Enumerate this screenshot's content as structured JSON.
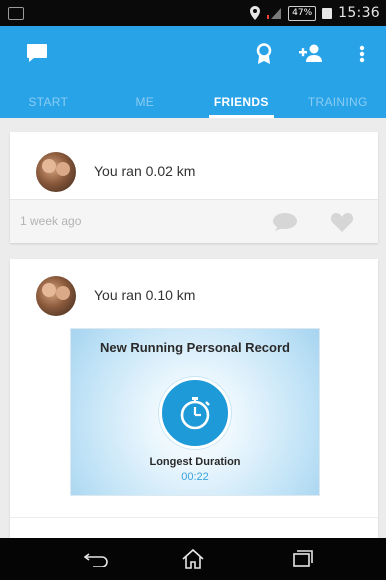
{
  "status_bar": {
    "time": "15:36",
    "battery": "47%"
  },
  "tabs": [
    {
      "label": "START",
      "active": false
    },
    {
      "label": "ME",
      "active": false
    },
    {
      "label": "FRIENDS",
      "active": true
    },
    {
      "label": "TRAINING",
      "active": false
    }
  ],
  "feed": [
    {
      "text": "You ran 0.02 km",
      "timestamp": "1 week ago"
    },
    {
      "text": "You ran 0.10 km",
      "record": {
        "title": "New Running Personal Record",
        "subtitle": "Longest Duration",
        "value": "00:22"
      }
    }
  ],
  "colors": {
    "app_bar": "#29a3e8",
    "accent": "#1e9ad8"
  },
  "icons": [
    "chat-icon",
    "award-icon",
    "add-friend-icon",
    "overflow-menu-icon",
    "comment-icon",
    "like-icon",
    "stopwatch-icon",
    "back-icon",
    "home-icon",
    "recent-apps-icon"
  ]
}
